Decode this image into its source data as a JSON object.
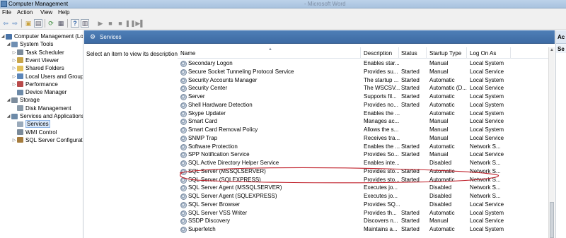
{
  "window": {
    "title": "Computer Management",
    "ghost_title": "- Microsoft Word"
  },
  "menu": [
    "File",
    "Action",
    "View",
    "Help"
  ],
  "tree": {
    "items": [
      {
        "label": "Computer Management (Local",
        "icon": "computer-icon",
        "color": "#4a74a8",
        "indent": 0,
        "expander": "◢",
        "selected": false
      },
      {
        "label": "System Tools",
        "icon": "toolbox-icon",
        "color": "#6f8fb3",
        "indent": 1,
        "expander": "◢",
        "selected": false
      },
      {
        "label": "Task Scheduler",
        "icon": "clock-icon",
        "color": "#7a8a9a",
        "indent": 2,
        "expander": "▷",
        "selected": false
      },
      {
        "label": "Event Viewer",
        "icon": "event-viewer-icon",
        "color": "#c9a64a",
        "indent": 2,
        "expander": "▷",
        "selected": false
      },
      {
        "label": "Shared Folders",
        "icon": "folder-icon",
        "color": "#e2c05a",
        "indent": 2,
        "expander": "▷",
        "selected": false
      },
      {
        "label": "Local Users and Groups",
        "icon": "users-icon",
        "color": "#5c86b9",
        "indent": 2,
        "expander": "▷",
        "selected": false
      },
      {
        "label": "Performance",
        "icon": "performance-icon",
        "color": "#b94a4a",
        "indent": 2,
        "expander": "▷",
        "selected": false
      },
      {
        "label": "Device Manager",
        "icon": "device-manager-icon",
        "color": "#6d8aa8",
        "indent": 2,
        "expander": "",
        "selected": false
      },
      {
        "label": "Storage",
        "icon": "storage-icon",
        "color": "#7c8c9c",
        "indent": 1,
        "expander": "◢",
        "selected": false
      },
      {
        "label": "Disk Management",
        "icon": "disk-icon",
        "color": "#8a9aa9",
        "indent": 2,
        "expander": "",
        "selected": false
      },
      {
        "label": "Services and Applications",
        "icon": "services-apps-icon",
        "color": "#6d8aa8",
        "indent": 1,
        "expander": "◢",
        "selected": false
      },
      {
        "label": "Services",
        "icon": "gear-icon",
        "color": "#9aaabb",
        "indent": 2,
        "expander": "",
        "selected": true
      },
      {
        "label": "WMI Control",
        "icon": "wmi-icon",
        "color": "#7a8a9a",
        "indent": 2,
        "expander": "",
        "selected": false
      },
      {
        "label": "SQL Server Configuratio",
        "icon": "sql-config-icon",
        "color": "#a67c3d",
        "indent": 2,
        "expander": "▷",
        "selected": false
      }
    ]
  },
  "services_header": {
    "title": "Services"
  },
  "description_pane": {
    "text": "Select an item to view its description."
  },
  "columns": [
    "Name",
    "Description",
    "Status",
    "Startup Type",
    "Log On As"
  ],
  "services": [
    {
      "name": "Secondary Logon",
      "desc": "Enables star...",
      "status": "",
      "startup": "Manual",
      "logon": "Local System"
    },
    {
      "name": "Secure Socket Tunneling Protocol Service",
      "desc": "Provides su...",
      "status": "Started",
      "startup": "Manual",
      "logon": "Local Service"
    },
    {
      "name": "Security Accounts Manager",
      "desc": "The startup ...",
      "status": "Started",
      "startup": "Automatic",
      "logon": "Local System"
    },
    {
      "name": "Security Center",
      "desc": "The WSCSV...",
      "status": "Started",
      "startup": "Automatic (D...",
      "logon": "Local Service"
    },
    {
      "name": "Server",
      "desc": "Supports fil...",
      "status": "Started",
      "startup": "Automatic",
      "logon": "Local System"
    },
    {
      "name": "Shell Hardware Detection",
      "desc": "Provides no...",
      "status": "Started",
      "startup": "Automatic",
      "logon": "Local System"
    },
    {
      "name": "Skype Updater",
      "desc": "Enables the ...",
      "status": "",
      "startup": "Automatic",
      "logon": "Local System"
    },
    {
      "name": "Smart Card",
      "desc": "Manages ac...",
      "status": "",
      "startup": "Manual",
      "logon": "Local Service"
    },
    {
      "name": "Smart Card Removal Policy",
      "desc": "Allows the s...",
      "status": "",
      "startup": "Manual",
      "logon": "Local System"
    },
    {
      "name": "SNMP Trap",
      "desc": "Receives tra...",
      "status": "",
      "startup": "Manual",
      "logon": "Local Service"
    },
    {
      "name": "Software Protection",
      "desc": "Enables the ...",
      "status": "Started",
      "startup": "Automatic",
      "logon": "Network S..."
    },
    {
      "name": "SPP Notification Service",
      "desc": "Provides So...",
      "status": "Started",
      "startup": "Manual",
      "logon": "Local Service"
    },
    {
      "name": "SQL Active Directory Helper Service",
      "desc": "Enables inte...",
      "status": "",
      "startup": "Disabled",
      "logon": "Network S..."
    },
    {
      "name": "SQL Server (MSSQLSERVER)",
      "desc": "Provides sto...",
      "status": "Started",
      "startup": "Automatic",
      "logon": "Network S..."
    },
    {
      "name": "SQL Server (SQLEXPRESS)",
      "desc": "Provides sto...",
      "status": "Started",
      "startup": "Automatic",
      "logon": "Network S..."
    },
    {
      "name": "SQL Server Agent (MSSQLSERVER)",
      "desc": "Executes jo...",
      "status": "",
      "startup": "Disabled",
      "logon": "Network S..."
    },
    {
      "name": "SQL Server Agent (SQLEXPRESS)",
      "desc": "Executes jo...",
      "status": "",
      "startup": "Disabled",
      "logon": "Network S..."
    },
    {
      "name": "SQL Server Browser",
      "desc": "Provides SQ...",
      "status": "",
      "startup": "Disabled",
      "logon": "Local Service"
    },
    {
      "name": "SQL Server VSS Writer",
      "desc": "Provides th...",
      "status": "Started",
      "startup": "Automatic",
      "logon": "Local System"
    },
    {
      "name": "SSDP Discovery",
      "desc": "Discovers n...",
      "status": "Started",
      "startup": "Manual",
      "logon": "Local Service"
    },
    {
      "name": "Superfetch",
      "desc": "Maintains a...",
      "status": "Started",
      "startup": "Automatic",
      "logon": "Local System"
    }
  ],
  "actions": {
    "title": "Ac",
    "subtitle": "Se"
  },
  "colors": {
    "header_band": "#4f7fb7",
    "annotation": "#c0212b",
    "selected_tree": "#d9e8fb"
  },
  "highlighted_service": "SQL Server (MSSQLSERVER)"
}
